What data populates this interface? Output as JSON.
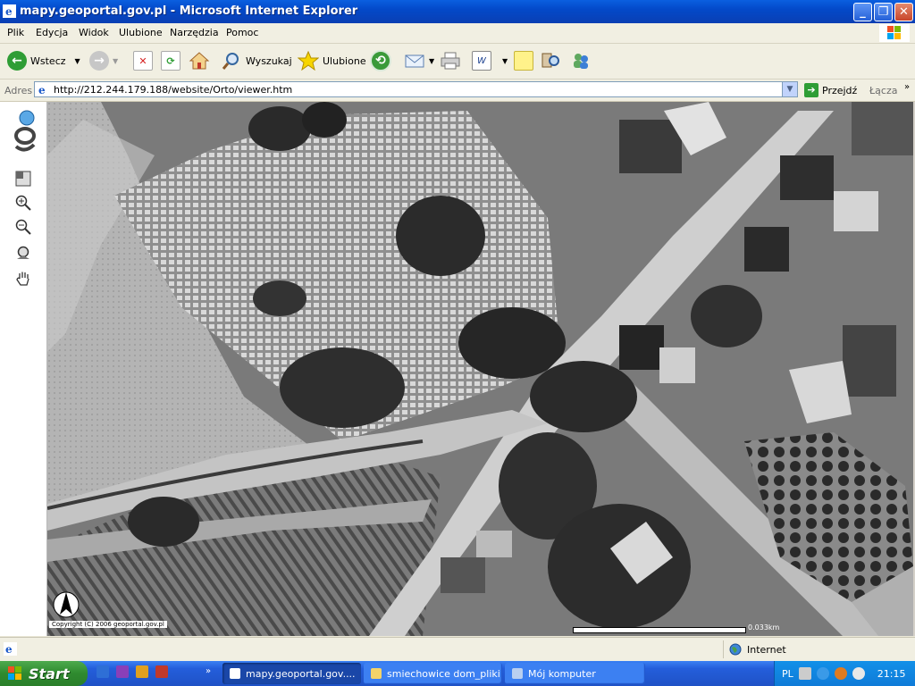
{
  "window": {
    "title": "mapy.geoportal.gov.pl - Microsoft Internet Explorer",
    "buttons": {
      "minimize": "_",
      "maximize": "❐",
      "close": "✕"
    }
  },
  "menu": {
    "items": [
      "Plik",
      "Edycja",
      "Widok",
      "Ulubione",
      "Narzędzia",
      "Pomoc"
    ]
  },
  "toolbar": {
    "back_label": "Wstecz",
    "search_label": "Wyszukaj",
    "favorites_label": "Ulubione"
  },
  "address": {
    "label": "Adres",
    "url": "http://212.244.179.188/website/Orto/viewer.htm",
    "go_label": "Przejdź",
    "links_label": "Łącza"
  },
  "map": {
    "copyright": "Copyright (C) 2006 geoportal.gov.pl",
    "scale_label": "0.033km"
  },
  "status": {
    "zone_label": "Internet"
  },
  "taskbar": {
    "start_label": "Start",
    "tasks": [
      {
        "label": "mapy.geoportal.gov...."
      },
      {
        "label": "smiechowice dom_pliki"
      },
      {
        "label": "Mój komputer"
      }
    ],
    "lang": "PL",
    "clock": "21:15"
  },
  "colors": {
    "titlebar": "#0A5FE0",
    "taskbar": "#245EDB",
    "start": "#2F8A2F"
  }
}
